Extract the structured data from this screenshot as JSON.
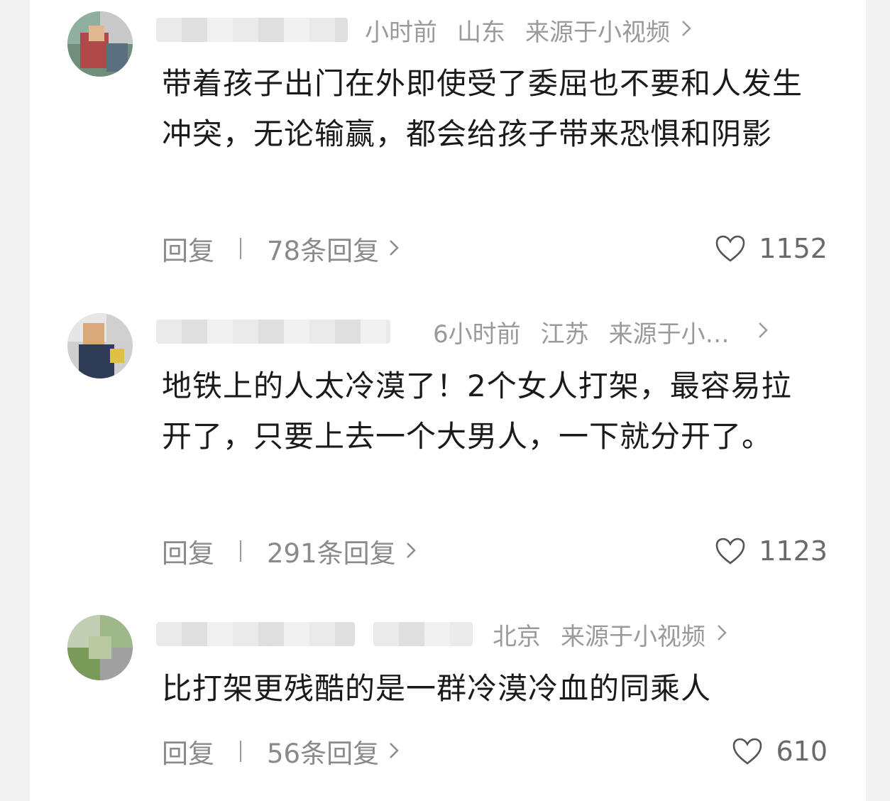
{
  "comments": [
    {
      "time": "小时前",
      "location": "山东",
      "source": "来源于小视频",
      "text": "带着孩子出门在外即使受了委屈也不要和人发生冲突，无论输赢，都会给孩子带来恐惧和阴影",
      "reply_label": "回复",
      "replies": "78条回复",
      "likes": "1152"
    },
    {
      "time": "6小时前",
      "location": "江苏",
      "source": "来源于小…",
      "text": "地铁上的人太冷漠了！2个女人打架，最容易拉开了，只要上去一个大男人，一下就分开了。",
      "reply_label": "回复",
      "replies": "291条回复",
      "likes": "1123"
    },
    {
      "time": "",
      "location": "北京",
      "source": "来源于小视频",
      "text": "比打架更残酷的是一群冷漠冷血的同乘人",
      "reply_label": "回复",
      "replies": "56条回复",
      "likes": "610"
    }
  ],
  "icons": {
    "chevron": "chevron-right-icon",
    "like": "heart-outline-icon"
  },
  "colors": {
    "background": "#f2f2f2",
    "card": "#ffffff",
    "text": "#1a1a1a",
    "meta": "#9a9a9a"
  }
}
